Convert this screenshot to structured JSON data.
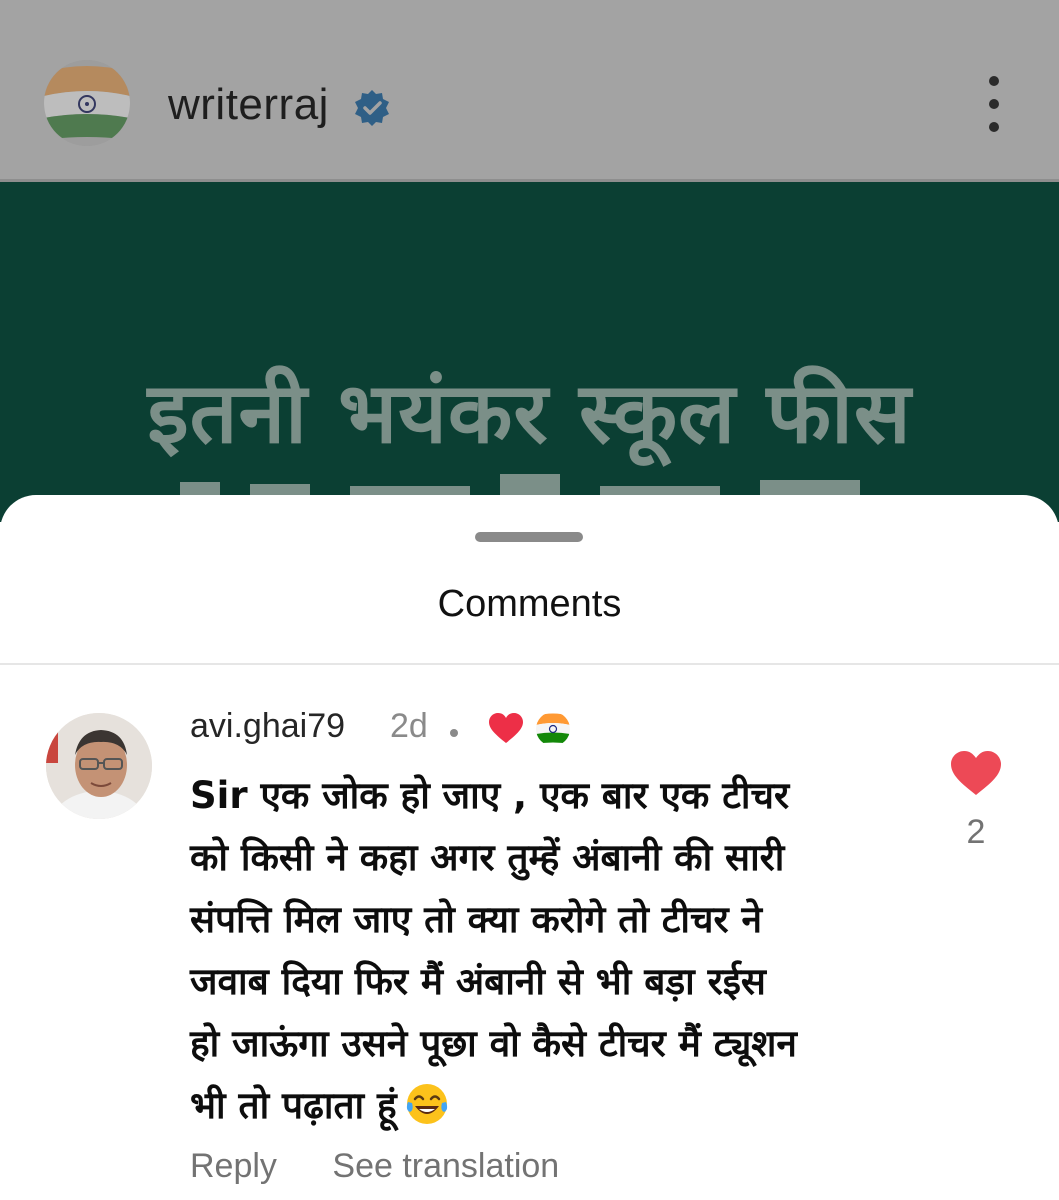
{
  "header": {
    "username": "writerraj",
    "verified_icon": "verified-badge-icon",
    "menu_icon": "more-vertical-icon"
  },
  "post": {
    "headline": "इतनी भयंकर स्कूल फीस",
    "background_color": "#0b3f33"
  },
  "sheet": {
    "title": "Comments"
  },
  "comment": {
    "username": "avi.ghai79",
    "time": "2d",
    "text_lines": [
      "Sir एक जोक हो जाए , एक बार एक टीचर",
      "को किसी ने कहा अगर तुम्हें अंबानी की सारी",
      "संपत्ति मिल जाए तो क्या करोगे तो टीचर ने",
      "जवाब दिया फिर मैं अंबानी से भी बड़ा रईस",
      "हो जाऊंगा उसने पूछा वो कैसे टीचर मैं ट्यूशन",
      "भी तो पढ़ाता हूं"
    ],
    "emoji": "face-with-tears-of-joy",
    "like_count": "2",
    "reply_label": "Reply",
    "translate_label": "See translation"
  },
  "colors": {
    "like_red": "#ed4956",
    "verified_blue": "#0095f6",
    "saffron": "#ff9933",
    "india_green": "#138808"
  }
}
